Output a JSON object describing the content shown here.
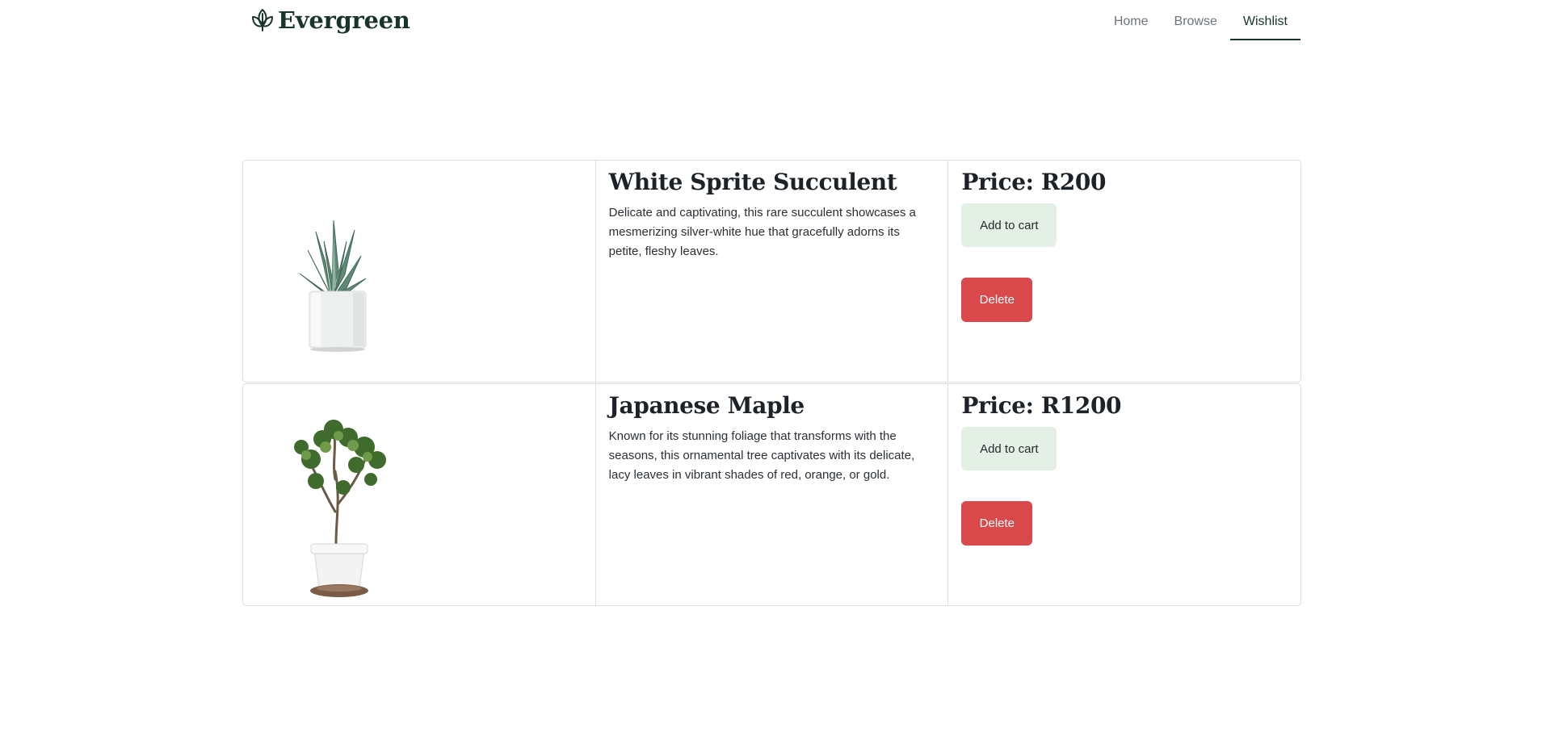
{
  "brand": {
    "name": "Evergreen"
  },
  "nav": {
    "items": [
      {
        "label": "Home"
      },
      {
        "label": "Browse"
      },
      {
        "label": "Wishlist"
      }
    ],
    "active": "Wishlist"
  },
  "wishlist": {
    "items": [
      {
        "name": "White Sprite Succulent",
        "description": "Delicate and captivating, this rare succulent showcases a mesmerizing silver-white hue that gracefully adorns its petite, fleshy leaves.",
        "price": "Price: R200",
        "add_label": "Add to cart",
        "delete_label": "Delete"
      },
      {
        "name": "Japanese Maple",
        "description": "Known for its stunning foliage that transforms with the seasons, this ornamental tree captivates with its delicate, lacy leaves in vibrant shades of red, orange, or gold.",
        "price": "Price: R1200",
        "add_label": "Add to cart",
        "delete_label": "Delete"
      }
    ]
  },
  "colors": {
    "brand": "#17352c",
    "cart_button": "#e4efe6",
    "delete_button": "#d9484a",
    "border": "#dcdfe2"
  },
  "icons": {
    "brand": "leaf-icon"
  }
}
